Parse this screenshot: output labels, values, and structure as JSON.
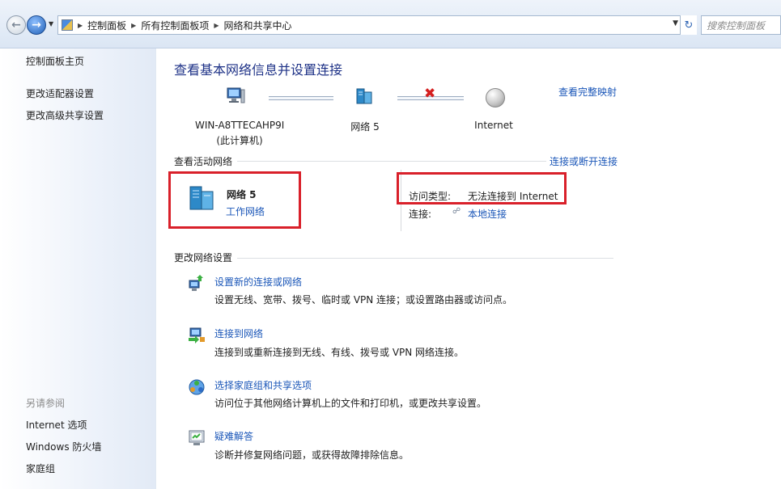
{
  "address_bar": {
    "breadcrumbs": [
      "控制面板",
      "所有控制面板项",
      "网络和共享中心"
    ],
    "search_placeholder": "搜索控制面板"
  },
  "sidebar": {
    "home": "控制面板主页",
    "links": [
      "更改适配器设置",
      "更改高级共享设置"
    ],
    "see_also_title": "另请参阅",
    "see_also": [
      "Internet 选项",
      "Windows 防火墙",
      "家庭组"
    ]
  },
  "main": {
    "title": "查看基本网络信息并设置连接",
    "view_full_map": "查看完整映射",
    "map": {
      "computer_name": "WIN-A8TTECAHP9I",
      "computer_sub": "(此计算机)",
      "network": "网络  5",
      "internet": "Internet"
    },
    "active_header": "查看活动网络",
    "connect_disconnect": "连接或断开连接",
    "active_network": {
      "name": "网络  5",
      "type": "工作网络",
      "access_type_label": "访问类型:",
      "access_type_value": "无法连接到 Internet",
      "connection_label": "连接:",
      "connection_value": "本地连接"
    },
    "change_header": "更改网络设置",
    "tasks": [
      {
        "icon": "network-setup-icon",
        "title": "设置新的连接或网络",
        "desc": "设置无线、宽带、拨号、临时或 VPN 连接；或设置路由器或访问点。"
      },
      {
        "icon": "connect-network-icon",
        "title": "连接到网络",
        "desc": "连接到或重新连接到无线、有线、拨号或 VPN 网络连接。"
      },
      {
        "icon": "homegroup-icon",
        "title": "选择家庭组和共享选项",
        "desc": "访问位于其他网络计算机上的文件和打印机，或更改共享设置。"
      },
      {
        "icon": "troubleshoot-icon",
        "title": "疑难解答",
        "desc": "诊断并修复网络问题，或获得故障排除信息。"
      }
    ]
  }
}
